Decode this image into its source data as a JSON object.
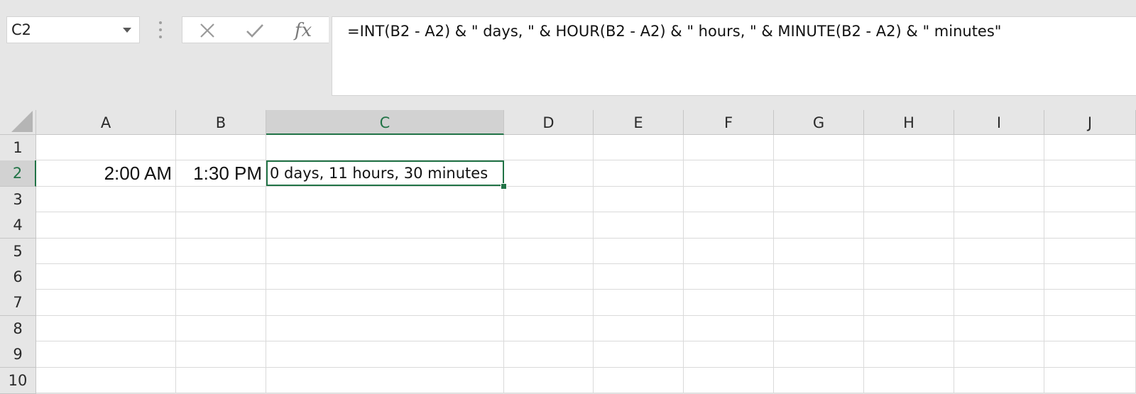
{
  "name_box": {
    "value": "C2"
  },
  "formula_bar": {
    "fx_label": "fx",
    "formula": "=INT(B2 - A2) & \" days, \" & HOUR(B2 - A2) & \" hours, \" & MINUTE(B2 - A2) & \" minutes\""
  },
  "columns": [
    "A",
    "B",
    "C",
    "D",
    "E",
    "F",
    "G",
    "H",
    "I",
    "J"
  ],
  "rows": [
    "1",
    "2",
    "3",
    "4",
    "5",
    "6",
    "7",
    "8",
    "9",
    "10"
  ],
  "active_cell": {
    "column": "C",
    "row": "2"
  },
  "cells": {
    "A2": "2:00 AM",
    "B2": "1:30 PM",
    "C2": "0 days, 11 hours, 30 minutes"
  },
  "colors": {
    "accent": "#217346",
    "header_bg": "#e6e6e6",
    "gridline": "#dadada"
  },
  "icons": {
    "cancel": "x-icon",
    "enter": "checkmark-icon",
    "function": "fx-icon"
  }
}
